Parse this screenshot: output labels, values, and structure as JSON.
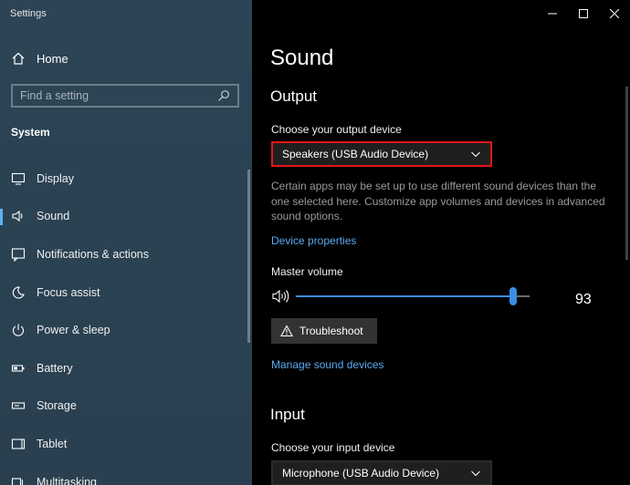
{
  "window": {
    "title": "Settings"
  },
  "sidebar": {
    "home_label": "Home",
    "search_placeholder": "Find a setting",
    "section_title": "System",
    "items": [
      {
        "label": "Display",
        "icon": "monitor-icon"
      },
      {
        "label": "Sound",
        "icon": "speaker-icon",
        "selected": true
      },
      {
        "label": "Notifications & actions",
        "icon": "notification-icon"
      },
      {
        "label": "Focus assist",
        "icon": "moon-icon"
      },
      {
        "label": "Power & sleep",
        "icon": "power-icon"
      },
      {
        "label": "Battery",
        "icon": "battery-icon"
      },
      {
        "label": "Storage",
        "icon": "storage-icon"
      },
      {
        "label": "Tablet",
        "icon": "tablet-icon"
      },
      {
        "label": "Multitasking",
        "icon": "multitasking-icon"
      }
    ]
  },
  "main": {
    "title": "Sound",
    "output": {
      "heading": "Output",
      "device_label": "Choose your output device",
      "device_value": "Speakers (USB Audio Device)",
      "description": "Certain apps may be set up to use different sound devices than the one selected here. Customize app volumes and devices in advanced sound options.",
      "device_properties_link": "Device properties",
      "master_volume_label": "Master volume",
      "master_volume_value": "93",
      "troubleshoot_label": "Troubleshoot",
      "manage_link": "Manage sound devices"
    },
    "input": {
      "heading": "Input",
      "device_label": "Choose your input device",
      "device_value": "Microphone (USB Audio Device)"
    }
  },
  "colors": {
    "sidebar_bg": "#2c4455",
    "accent": "#3b8ee4",
    "link": "#5aa9f0",
    "focus_border": "#e0161b"
  }
}
